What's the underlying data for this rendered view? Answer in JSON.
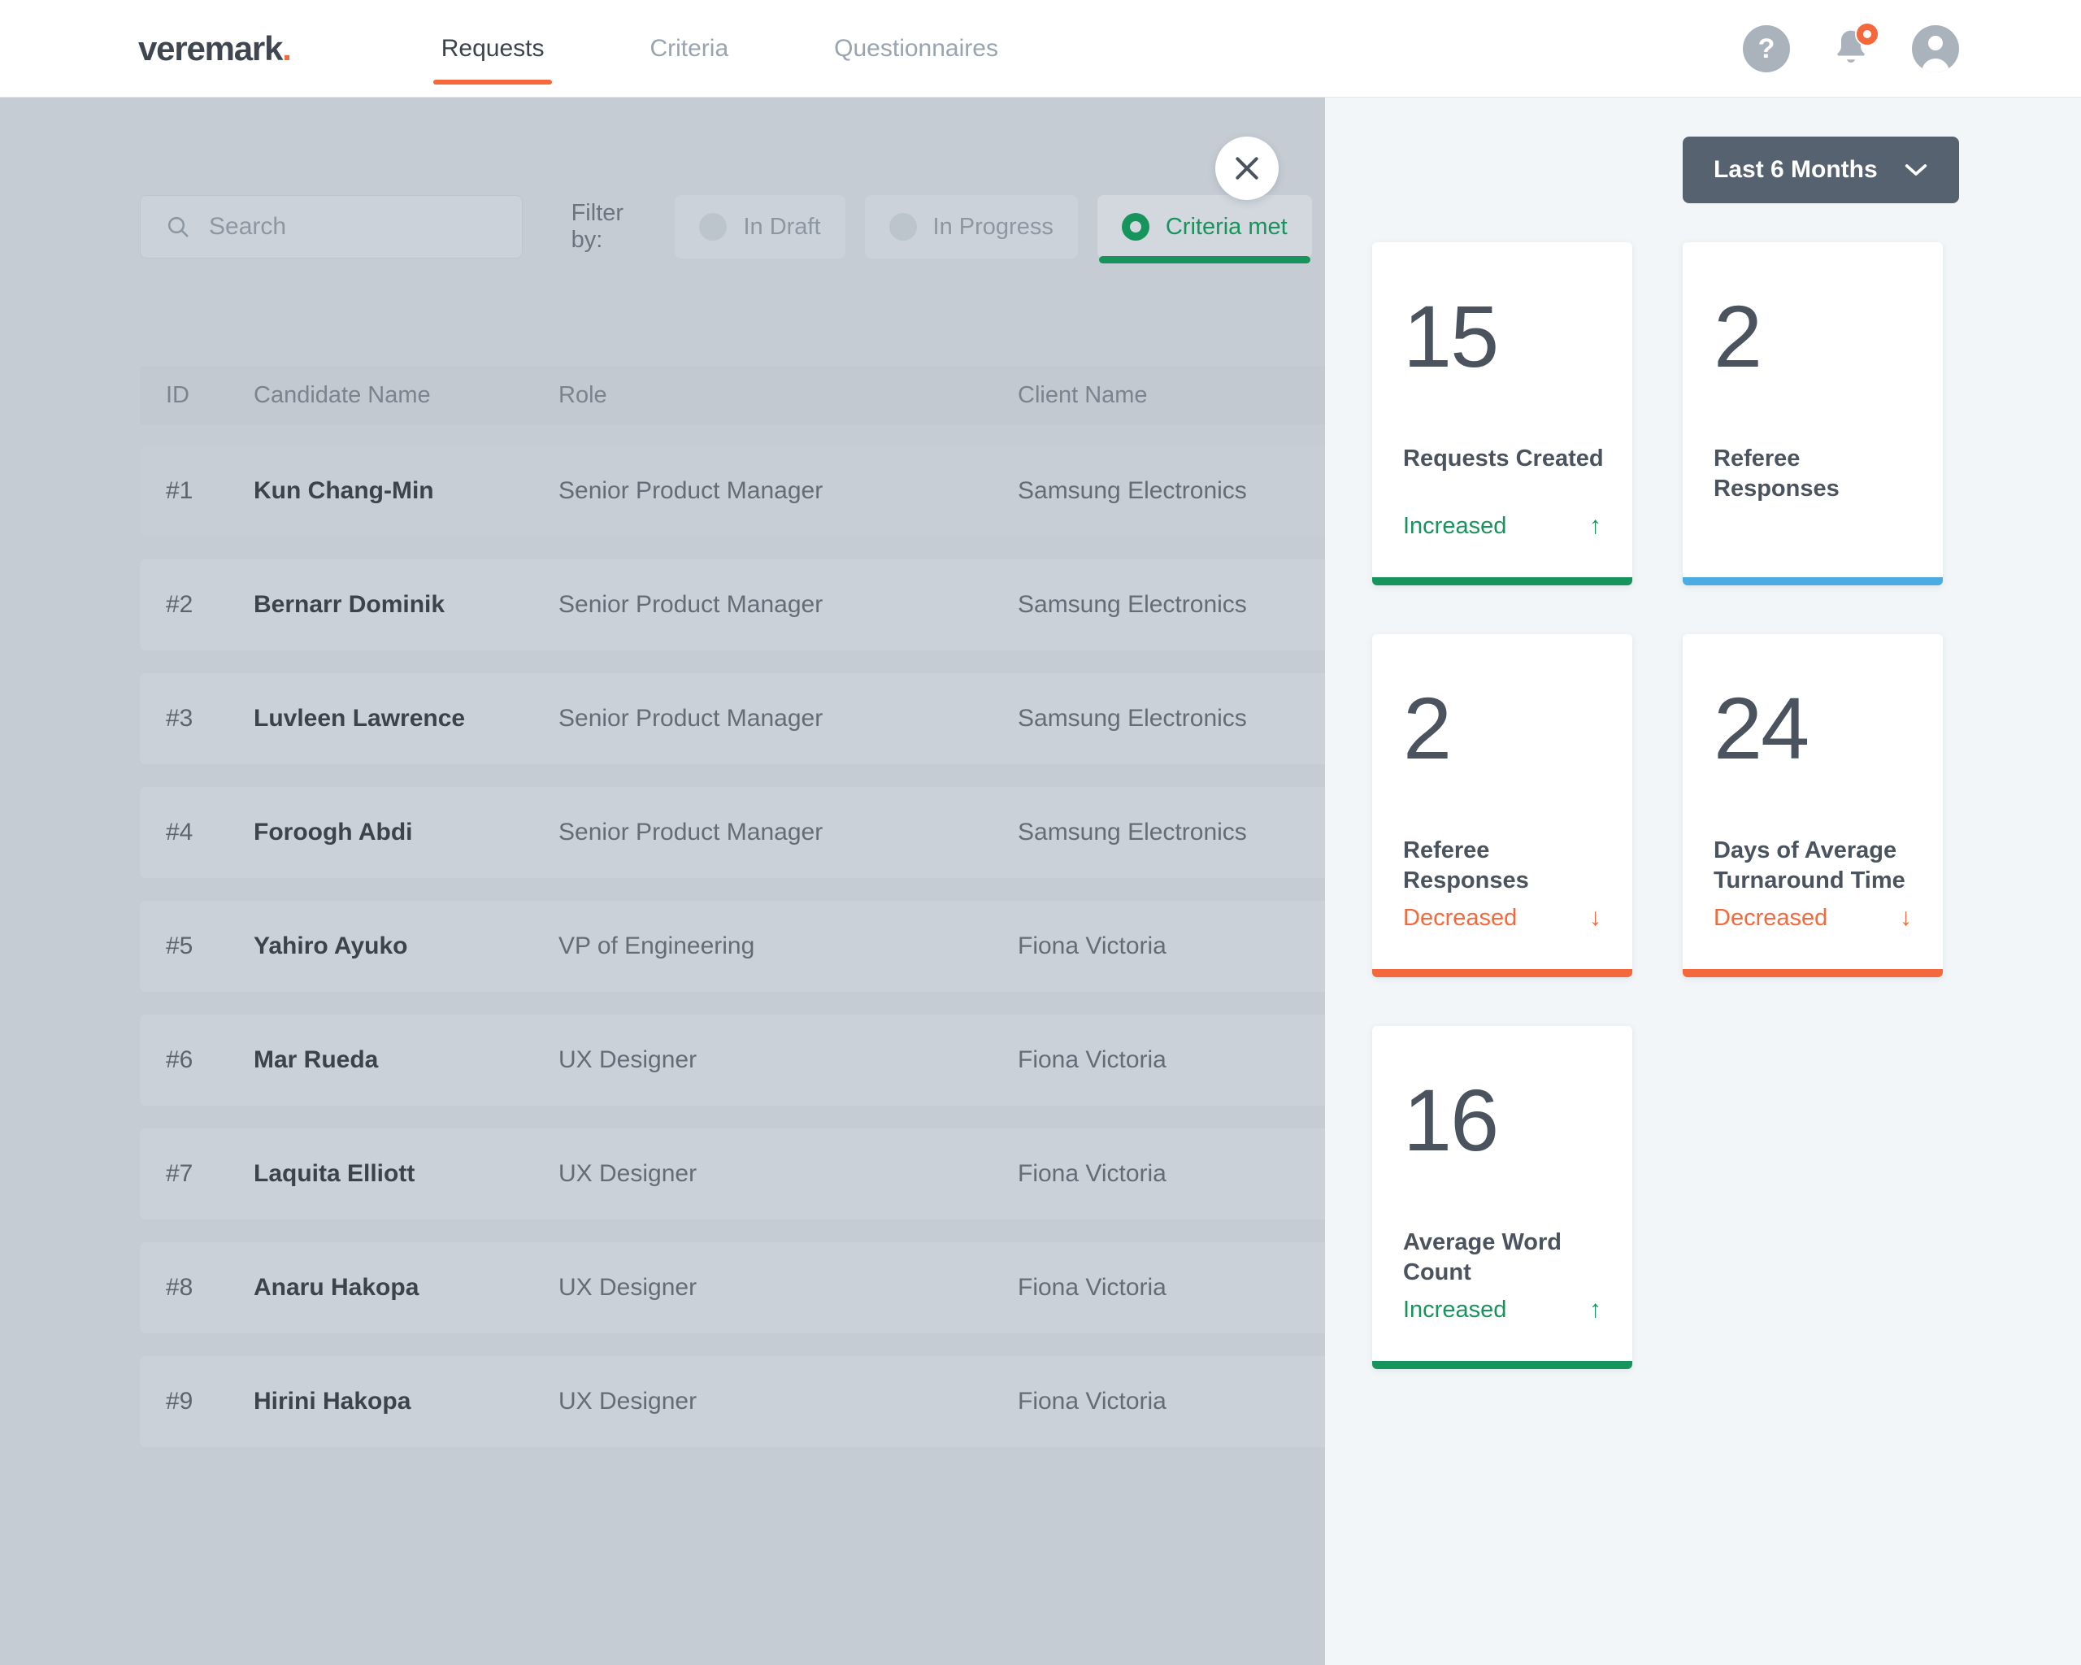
{
  "header": {
    "logo_text": "veremark",
    "logo_dot": ".",
    "nav": [
      {
        "label": "Requests",
        "active": true
      },
      {
        "label": "Criteria",
        "active": false
      },
      {
        "label": "Questionnaires",
        "active": false
      }
    ],
    "help_label": "?",
    "help_icon": "question-mark-icon",
    "bell_icon": "notification-bell-icon",
    "avatar_icon": "user-avatar-icon",
    "notification_badge": ""
  },
  "toolbar": {
    "search_placeholder": "Search",
    "search_value": "",
    "search_icon": "search-icon",
    "filter_label": "Filter by:",
    "chips": [
      {
        "label": "In Draft",
        "selected": false
      },
      {
        "label": "In Progress",
        "selected": false
      },
      {
        "label": "Criteria met",
        "selected": true
      }
    ]
  },
  "close_button": {
    "icon": "close-icon",
    "label": ""
  },
  "table": {
    "columns": [
      "ID",
      "Candidate Name",
      "Role",
      "Client Name"
    ],
    "rows": [
      {
        "id": "#1",
        "name": "Kun Chang-Min",
        "role": "Senior Product Manager",
        "client": "Samsung Electronics"
      },
      {
        "id": "#2",
        "name": "Bernarr Dominik",
        "role": "Senior Product Manager",
        "client": "Samsung Electronics"
      },
      {
        "id": "#3",
        "name": "Luvleen Lawrence",
        "role": "Senior Product Manager",
        "client": "Samsung Electronics"
      },
      {
        "id": "#4",
        "name": "Foroogh Abdi",
        "role": "Senior Product Manager",
        "client": "Samsung Electronics"
      },
      {
        "id": "#5",
        "name": "Yahiro Ayuko",
        "role": "VP of Engineering",
        "client": "Fiona Victoria"
      },
      {
        "id": "#6",
        "name": "Mar Rueda",
        "role": "UX Designer",
        "client": "Fiona Victoria"
      },
      {
        "id": "#7",
        "name": "Laquita Elliott",
        "role": "UX Designer",
        "client": "Fiona Victoria"
      },
      {
        "id": "#8",
        "name": "Anaru Hakopa",
        "role": "UX Designer",
        "client": "Fiona Victoria"
      },
      {
        "id": "#9",
        "name": "Hirini Hakopa",
        "role": "UX Designer",
        "client": "Fiona Victoria"
      }
    ]
  },
  "panel": {
    "range_selector": {
      "value": "Last 6 Months",
      "icon": "chevron-down-icon"
    },
    "cards": [
      {
        "value": "15",
        "label": "Requests Created",
        "trend": "Increased",
        "direction": "up",
        "arrow": "↑",
        "accent": "#17945c"
      },
      {
        "value": "2",
        "label": "Referee Responses",
        "trend": "",
        "direction": "none",
        "arrow": "",
        "accent": "#4aace0"
      },
      {
        "value": "2",
        "label": "Referee Responses",
        "trend": "Decreased",
        "direction": "down",
        "arrow": "↓",
        "accent": "#f4683c"
      },
      {
        "value": "24",
        "label": "Days of Average Turnaround Time",
        "trend": "Decreased",
        "direction": "down",
        "arrow": "↓",
        "accent": "#f4683c"
      },
      {
        "value": "16",
        "label": "Average Word Count",
        "trend": "Increased",
        "direction": "up",
        "arrow": "↑",
        "accent": "#17945c"
      }
    ]
  },
  "colors": {
    "brand_orange": "#f4683c",
    "success_green": "#17945c",
    "info_blue": "#4aace0",
    "panel_bg": "#f2f6f8",
    "backdrop": "#c6ccd4",
    "dark_slate": "#566270"
  }
}
